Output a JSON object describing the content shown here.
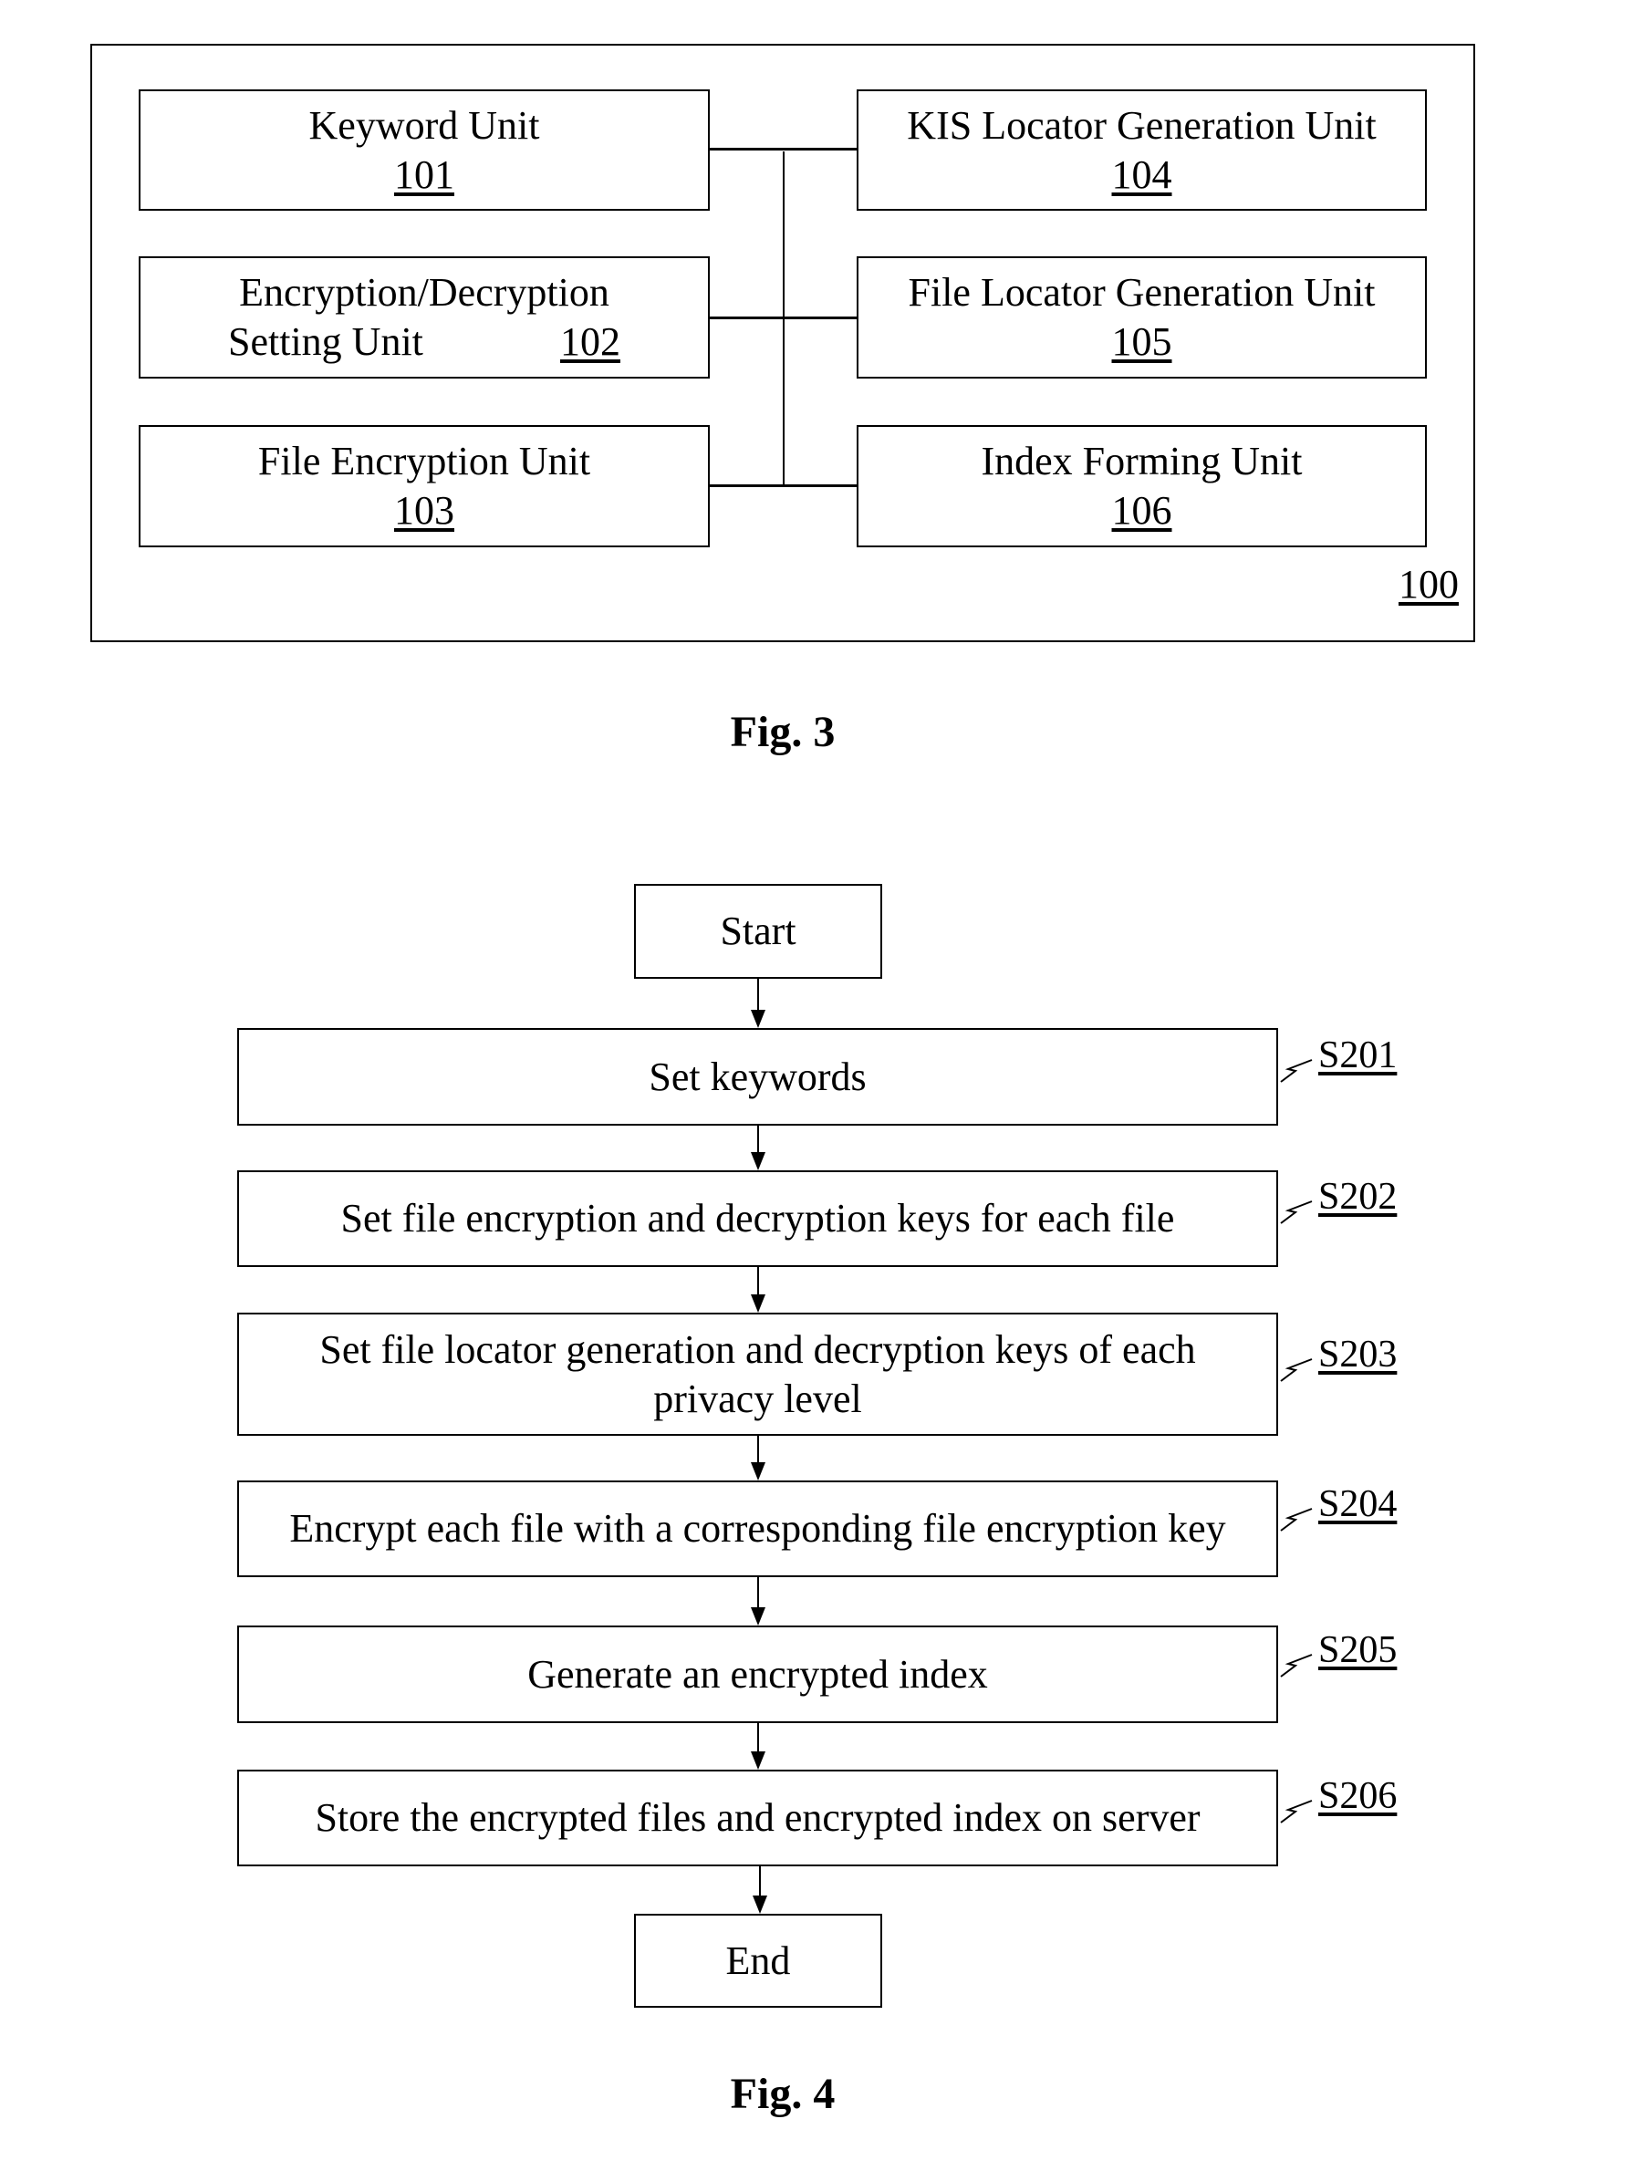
{
  "fig3": {
    "caption": "Fig. 3",
    "container_ref": "100",
    "units": [
      {
        "name": "Keyword Unit",
        "ref": "101"
      },
      {
        "name": "Encryption/Decryption",
        "name2": "Setting Unit",
        "ref": "102"
      },
      {
        "name": "File Encryption Unit",
        "ref": "103"
      },
      {
        "name": "KIS Locator Generation Unit",
        "ref": "104"
      },
      {
        "name": "File Locator Generation Unit",
        "ref": "105"
      },
      {
        "name": "Index Forming Unit",
        "ref": "106"
      }
    ]
  },
  "fig4": {
    "caption": "Fig. 4",
    "start": "Start",
    "end": "End",
    "steps": [
      {
        "id": "S201",
        "text": "Set keywords"
      },
      {
        "id": "S202",
        "text": "Set file encryption and decryption keys for each file"
      },
      {
        "id": "S203",
        "text": "Set file locator generation and decryption keys of each",
        "text2": "privacy level"
      },
      {
        "id": "S204",
        "text": "Encrypt each file with a corresponding file encryption key"
      },
      {
        "id": "S205",
        "text": "Generate an encrypted index"
      },
      {
        "id": "S206",
        "text": "Store the encrypted files and encrypted index on server"
      }
    ]
  }
}
